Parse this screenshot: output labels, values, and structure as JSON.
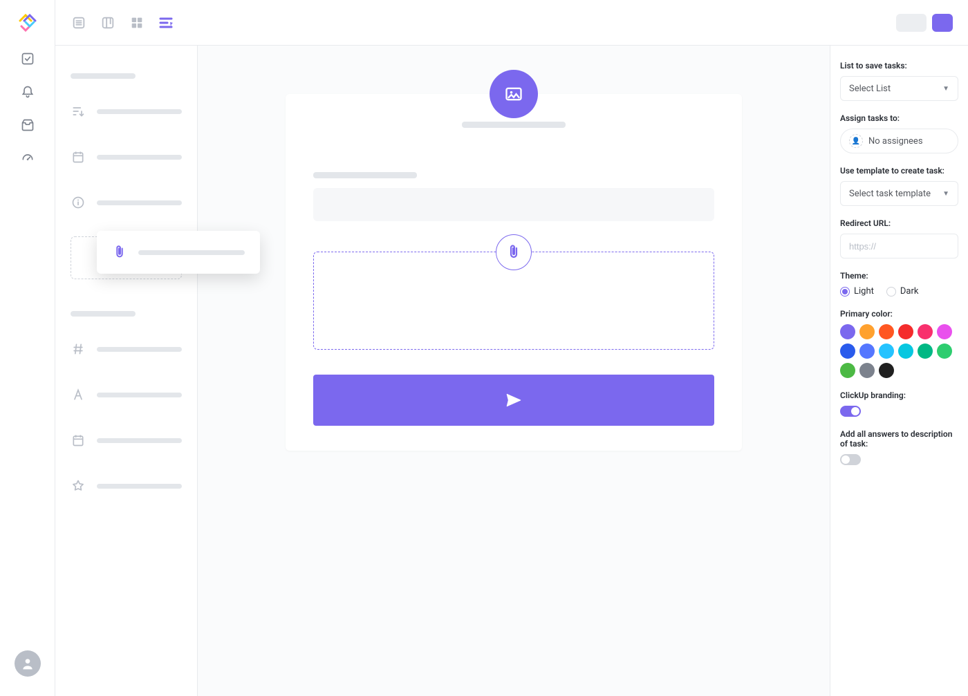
{
  "topbar": {
    "views": [
      "list-view-icon",
      "board-view-icon",
      "box-view-icon",
      "form-view-icon"
    ],
    "active_view": "form-view-icon"
  },
  "rail_icons": [
    "tasks-icon",
    "notifications-icon",
    "inbox-icon",
    "dashboards-icon"
  ],
  "fields": {
    "section_a": [
      "sort-icon",
      "date-icon",
      "info-icon"
    ],
    "dragging": "attachment-icon",
    "section_b": [
      "hash-icon",
      "text-icon",
      "date-icon",
      "star-icon"
    ]
  },
  "settings": {
    "list_label": "List to save tasks:",
    "list_value": "Select List",
    "assign_label": "Assign tasks to:",
    "assign_value": "No assignees",
    "template_label": "Use template to create task:",
    "template_value": "Select task template",
    "redirect_label": "Redirect URL:",
    "redirect_placeholder": "https://",
    "theme_label": "Theme:",
    "theme_light": "Light",
    "theme_dark": "Dark",
    "theme_selected": "light",
    "color_label": "Primary color:",
    "colors": [
      "#7b68ee",
      "#ffa12f",
      "#ff5722",
      "#f42c2c",
      "#f8306d",
      "#e950ed",
      "#2a5bec",
      "#5577ff",
      "#25c3ff",
      "#08c7e0",
      "#00b884",
      "#2ecd6f",
      "#4cb944",
      "#7c828d",
      "#202020"
    ],
    "branding_label": "ClickUp branding:",
    "branding_on": true,
    "desc_label": "Add all answers to description of task:",
    "desc_on": false
  }
}
